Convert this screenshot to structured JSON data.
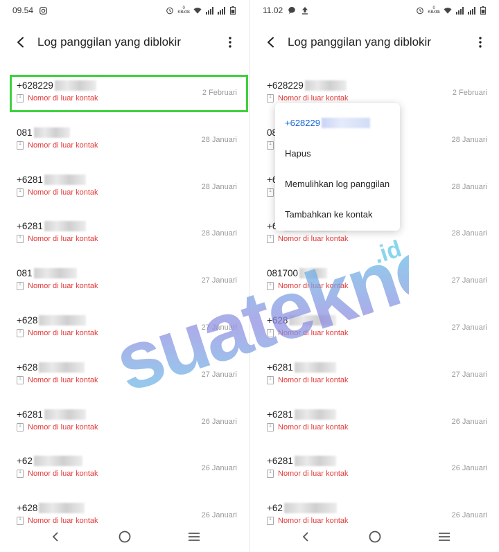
{
  "left": {
    "status": {
      "time": "09.54"
    },
    "title": "Log panggilan yang diblokir",
    "rows": [
      {
        "number": "+628229",
        "blur": 60,
        "sub": "Nomor di luar kontak",
        "date": "2 Februari"
      },
      {
        "number": "081",
        "blur": 52,
        "sub": "Nomor di luar kontak",
        "date": "28 Januari"
      },
      {
        "number": "+6281",
        "blur": 60,
        "sub": "Nomor di luar kontak",
        "date": "28 Januari"
      },
      {
        "number": "+6281",
        "blur": 60,
        "sub": "Nomor di luar kontak",
        "date": "28 Januari"
      },
      {
        "number": "081",
        "blur": 62,
        "sub": "Nomor di luar kontak",
        "date": "27 Januari"
      },
      {
        "number": "+628",
        "blur": 68,
        "sub": "Nomor di luar kontak",
        "date": "27 Januari"
      },
      {
        "number": "+628",
        "blur": 66,
        "sub": "Nomor di luar kontak",
        "date": "27 Januari"
      },
      {
        "number": "+6281",
        "blur": 60,
        "sub": "Nomor di luar kontak",
        "date": "26 Januari"
      },
      {
        "number": "+62",
        "blur": 70,
        "sub": "Nomor di luar kontak",
        "date": "26 Januari"
      },
      {
        "number": "+628",
        "blur": 66,
        "sub": "Nomor di luar kontak",
        "date": "26 Januari"
      }
    ]
  },
  "right": {
    "status": {
      "time": "11.02"
    },
    "title": "Log panggilan yang diblokir",
    "rows": [
      {
        "number": "+628229",
        "blur": 60,
        "sub": "Nomor di luar kontak",
        "date": "2 Februari"
      },
      {
        "number": "08",
        "blur": 10,
        "sub": "Nomor di luar kontak",
        "date": "28 Januari"
      },
      {
        "number": "+6",
        "blur": 10,
        "sub": "Nomor di luar kontak",
        "date": "28 Januari"
      },
      {
        "number": "+62",
        "blur": 90,
        "sub": "Nomor di luar kontak",
        "date": "28 Januari"
      },
      {
        "number": "081700",
        "blur": 40,
        "sub": "Nomor di luar kontak",
        "date": "27 Januari"
      },
      {
        "number": "+628",
        "blur": 68,
        "sub": "Nomor di luar kontak",
        "date": "27 Januari"
      },
      {
        "number": "+6281",
        "blur": 60,
        "sub": "Nomor di luar kontak",
        "date": "27 Januari"
      },
      {
        "number": "+6281",
        "blur": 60,
        "sub": "Nomor di luar kontak",
        "date": "26 Januari"
      },
      {
        "number": "+6281",
        "blur": 60,
        "sub": "Nomor di luar kontak",
        "date": "26 Januari"
      },
      {
        "number": "+62",
        "blur": 76,
        "sub": "Nomor di luar kontak",
        "date": "26 Januari"
      }
    ],
    "menu": {
      "phone": "+628229",
      "items": [
        "Hapus",
        "Memulihkan log panggilan",
        "Tambahkan ke kontak"
      ]
    }
  },
  "status_common": {
    "speed_top": "0",
    "speed_bottom": "KB/dtk"
  },
  "watermark": {
    "text": "suatekno",
    "suffix": ".id"
  },
  "colors": {
    "accent": "#1565d8",
    "warning": "#e23a3a",
    "highlight": "#3ed13e"
  }
}
